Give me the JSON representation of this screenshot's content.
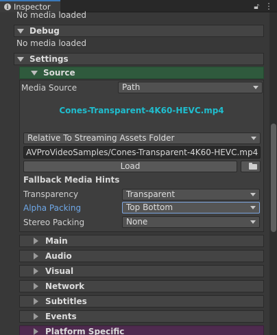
{
  "window": {
    "tab_title": "Inspector",
    "tab_icon": "info-icon",
    "lock_icon": "lock-icon",
    "menu_icon": "kebab-menu-icon"
  },
  "top_status": "No media loaded",
  "debug": {
    "title": "Debug",
    "status": "No media loaded"
  },
  "settings": {
    "title": "Settings",
    "source": {
      "title": "Source",
      "media_source_label": "Media Source",
      "media_source_value": "Path",
      "media_name": "Cones-Transparent-4K60-HEVC.mp4",
      "path_mode": "Relative To Streaming Assets Folder",
      "path_value": "AVProVideoSamples/Cones-Transparent-4K60-HEVC.mp4",
      "load_label": "Load",
      "browse_icon": "folder-icon",
      "fallback_title": "Fallback Media Hints",
      "transparency_label": "Transparency",
      "transparency_value": "Transparent",
      "alpha_label": "Alpha Packing",
      "alpha_value": "Top Bottom",
      "stereo_label": "Stereo Packing",
      "stereo_value": "None"
    },
    "collapsed_sections": [
      "Main",
      "Audio",
      "Visual",
      "Network",
      "Subtitles",
      "Events",
      "Platform Specific"
    ]
  },
  "colors": {
    "source_header": "#2f5a3d",
    "platform_header": "#4f2a4f",
    "media_name": "#1fbecf",
    "accent_label": "#6fa8e8"
  }
}
